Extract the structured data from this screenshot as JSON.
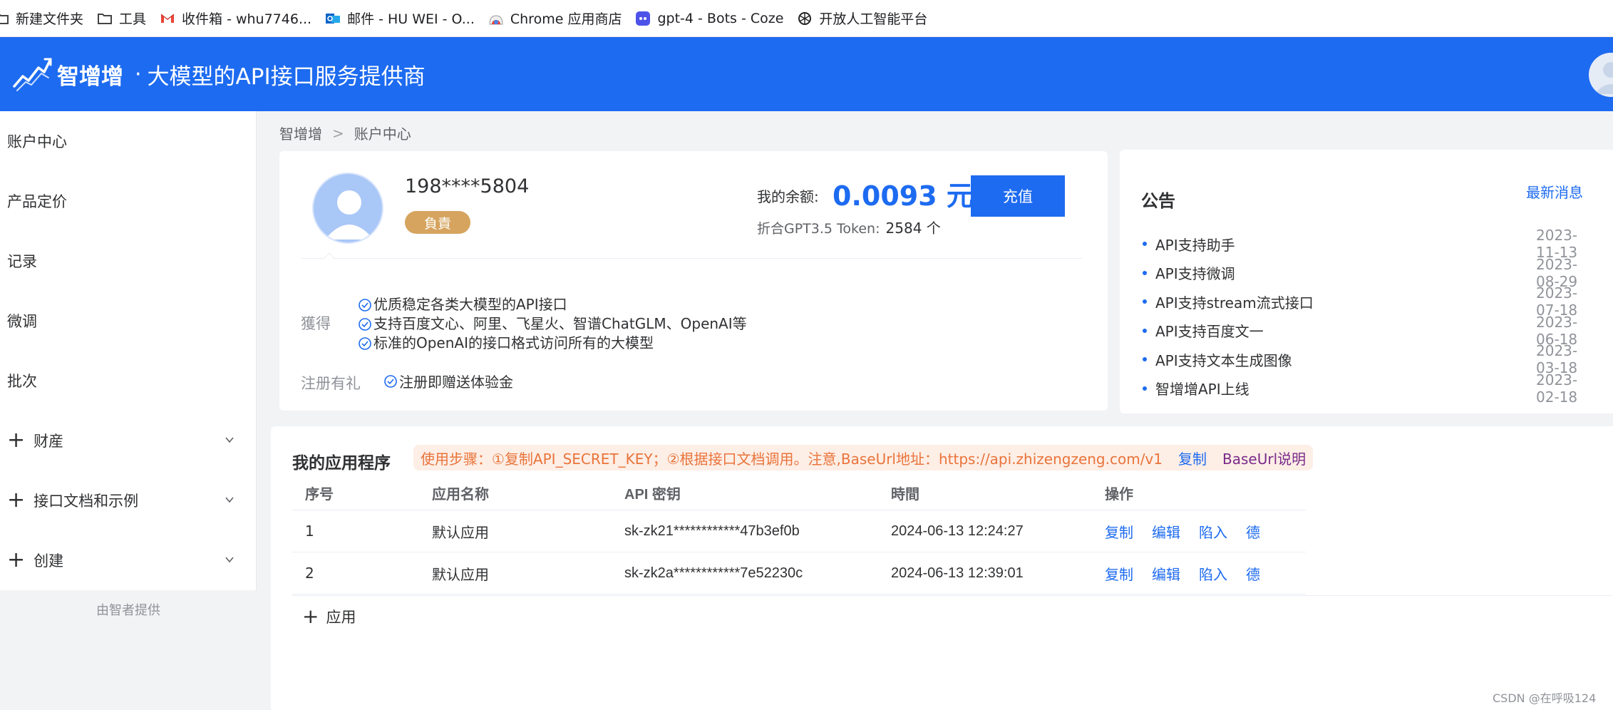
{
  "bookmarks": [
    {
      "label": "新建文件夹",
      "icon": "folder-icon"
    },
    {
      "label": "工具",
      "icon": "folder-icon"
    },
    {
      "label": "收件箱 - whu7746...",
      "icon": "gmail-icon"
    },
    {
      "label": "邮件 - HU WEI - O...",
      "icon": "outlook-icon"
    },
    {
      "label": "Chrome 应用商店",
      "icon": "chrome-store-icon"
    },
    {
      "label": "gpt-4 - Bots - Coze",
      "icon": "coze-icon"
    },
    {
      "label": "开放人工智能平台",
      "icon": "openai-icon"
    }
  ],
  "header": {
    "brand": "智增增",
    "dot": "·",
    "subtitle": "大模型的API接口服务提供商"
  },
  "sidebar": {
    "items": [
      {
        "label": "账户中心"
      },
      {
        "label": "产品定价"
      },
      {
        "label": "记录"
      },
      {
        "label": "微调"
      },
      {
        "label": "批次"
      },
      {
        "label": "财産"
      },
      {
        "label": "接口文档和示例"
      },
      {
        "label": "创建"
      }
    ],
    "footer": "由智者提供"
  },
  "breadcrumb": {
    "root": "智增增",
    "sep": ">",
    "current": "账户中心"
  },
  "user": {
    "phone": "198****5804",
    "badge": "負責",
    "balance_label": "我的余额:",
    "balance_value": "0.0093 元",
    "token_label": "折合GPT3.5 Token:",
    "token_value": "2584 个",
    "recharge_label": "充值",
    "benefit_label": "獲得",
    "benefits": [
      "优质稳定各类大模型的API接口",
      "支持百度文心、阿里、飞星火、智谱ChatGLM、OpenAI等",
      "标准的OpenAI的接口格式访问所有的大模型"
    ],
    "gift_label": "注册有礼",
    "gift_text": "注册即赠送体验金"
  },
  "notice": {
    "title": "公告",
    "more": "最新消息",
    "items": [
      {
        "text": "API支持助手",
        "date": "2023-11-13"
      },
      {
        "text": "API支持微调",
        "date": "2023-08-29"
      },
      {
        "text": "API支持stream流式接口",
        "date": "2023-07-18"
      },
      {
        "text": "API支持百度文一",
        "date": "2023-06-18"
      },
      {
        "text": "API支持文本生成图像",
        "date": "2023-03-18"
      },
      {
        "text": "智增增API上线",
        "date": "2023-02-18"
      }
    ]
  },
  "apps": {
    "title": "我的应用程序",
    "tip": "使用步骤：①复制API_SECRET_KEY；②根据接口文档调用。注意,BaseUrl地址：https://api.zhizengzeng.com/v1",
    "tip_copy": "复制",
    "tip_explain": "BaseUrl说明",
    "columns": [
      "序号",
      "应用名称",
      "API 密钥",
      "時間",
      "操作"
    ],
    "rows": [
      {
        "index": "1",
        "name": "默认应用",
        "key": "sk-zk21************47b3ef0b",
        "time": "2024-06-13 12:24:27",
        "ops": [
          "复制",
          "编辑",
          "陷入",
          "德"
        ]
      },
      {
        "index": "2",
        "name": "默认应用",
        "key": "sk-zk2a************7e52230c",
        "time": "2024-06-13 12:39:01",
        "ops": [
          "复制",
          "编辑",
          "陷入",
          "德"
        ]
      }
    ],
    "add_label": "应用"
  },
  "watermark": "CSDN @在呼吸124",
  "colors": {
    "primary": "#1d6bf0",
    "badge": "#d6a45e",
    "tip_text": "#e9743a",
    "tip_bg": "#fdeee6"
  }
}
